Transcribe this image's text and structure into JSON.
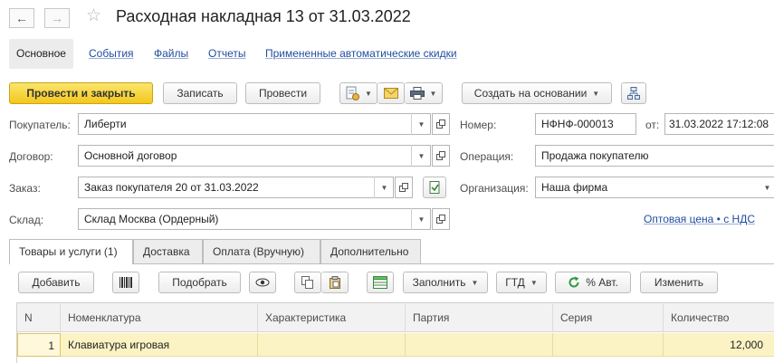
{
  "header": {
    "title": "Расходная накладная 13 от 31.03.2022"
  },
  "nav": {
    "tabs": [
      "Основное",
      "События",
      "Файлы",
      "Отчеты",
      "Примененные автоматические скидки"
    ]
  },
  "toolbar": {
    "post_close_label": "Провести и закрыть",
    "write_label": "Записать",
    "post_label": "Провести",
    "create_based_label": "Создать на основании"
  },
  "form": {
    "buyer": {
      "label": "Покупатель:",
      "value": "Либерти"
    },
    "contract": {
      "label": "Договор:",
      "value": "Основной договор"
    },
    "order": {
      "label": "Заказ:",
      "value": "Заказ покупателя 20 от 31.03.2022"
    },
    "warehouse": {
      "label": "Склад:",
      "value": "Склад Москва (Ордерный)"
    },
    "number": {
      "label": "Номер:",
      "value": "НФНФ-000013"
    },
    "date": {
      "label": "от:",
      "value": "31.03.2022 17:12:08"
    },
    "operation": {
      "label": "Операция:",
      "value": "Продажа покупателю"
    },
    "organization": {
      "label": "Организация:",
      "value": "Наша фирма"
    },
    "price_link": "Оптовая цена • с НДС"
  },
  "tabs": {
    "items": [
      "Товары и услуги (1)",
      "Доставка",
      "Оплата (Вручную)",
      "Дополнительно"
    ]
  },
  "table_toolbar": {
    "add_label": "Добавить",
    "pick_label": "Подобрать",
    "fill_label": "Заполнить",
    "gtd_label": "ГТД",
    "auto_discount_label": "% Авт.",
    "change_label": "Изменить"
  },
  "table": {
    "columns": [
      "N",
      "Номенклатура",
      "Характеристика",
      "Партия",
      "Серия",
      "Количество"
    ],
    "rows": [
      {
        "n": "1",
        "item": "Клавиатура игровая",
        "characteristic": "",
        "batch": "",
        "series": "",
        "quantity": "12,000"
      }
    ]
  },
  "colors": {
    "primary_button": "#f3c81d",
    "selected_row": "#fbf3c3",
    "link": "#1f4d9e"
  }
}
